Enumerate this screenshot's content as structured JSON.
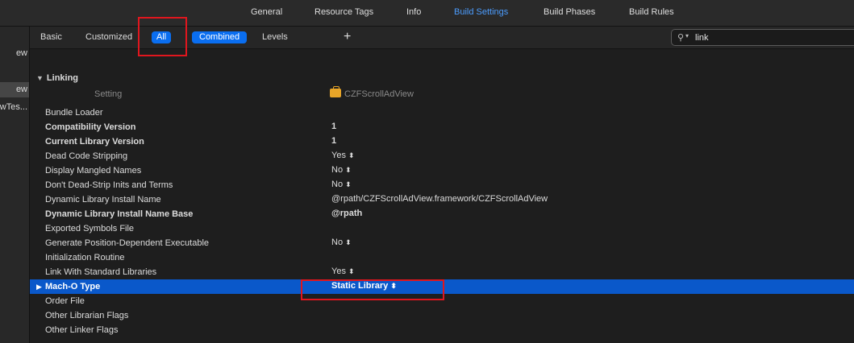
{
  "tabs": [
    "General",
    "Resource Tags",
    "Info",
    "Build Settings",
    "Build Phases",
    "Build Rules"
  ],
  "active_tab": "Build Settings",
  "sidebar": {
    "items": [
      "ew",
      "ew",
      "wTes..."
    ]
  },
  "filter": {
    "basic": "Basic",
    "customized": "Customized",
    "all": "All",
    "combined": "Combined",
    "levels": "Levels",
    "add": "+",
    "search_value": "link"
  },
  "section": {
    "title": "Linking",
    "setting_header": "Setting",
    "target_header": "CZFScrollAdView"
  },
  "rows": [
    {
      "name": "Bundle Loader",
      "value": "",
      "bold": false
    },
    {
      "name": "Compatibility Version",
      "value": "1",
      "bold": true
    },
    {
      "name": "Current Library Version",
      "value": "1",
      "bold": true
    },
    {
      "name": "Dead Code Stripping",
      "value": "Yes",
      "bold": false,
      "stepper": true
    },
    {
      "name": "Display Mangled Names",
      "value": "No",
      "bold": false,
      "stepper": true
    },
    {
      "name": "Don't Dead-Strip Inits and Terms",
      "value": "No",
      "bold": false,
      "stepper": true
    },
    {
      "name": "Dynamic Library Install Name",
      "value": "@rpath/CZFScrollAdView.framework/CZFScrollAdView",
      "bold": false
    },
    {
      "name": "Dynamic Library Install Name Base",
      "value": "@rpath",
      "bold": true
    },
    {
      "name": "Exported Symbols File",
      "value": "",
      "bold": false
    },
    {
      "name": "Generate Position-Dependent Executable",
      "value": "No",
      "bold": false,
      "stepper": true
    },
    {
      "name": "Initialization Routine",
      "value": "",
      "bold": false
    },
    {
      "name": "Link With Standard Libraries",
      "value": "Yes",
      "bold": false,
      "stepper": true
    },
    {
      "name": "Mach-O Type",
      "value": "Static Library",
      "bold": true,
      "stepper": true,
      "selected": true
    },
    {
      "name": "Order File",
      "value": "",
      "bold": false
    },
    {
      "name": "Other Librarian Flags",
      "value": "",
      "bold": false
    },
    {
      "name": "Other Linker Flags",
      "value": "",
      "bold": false
    }
  ]
}
